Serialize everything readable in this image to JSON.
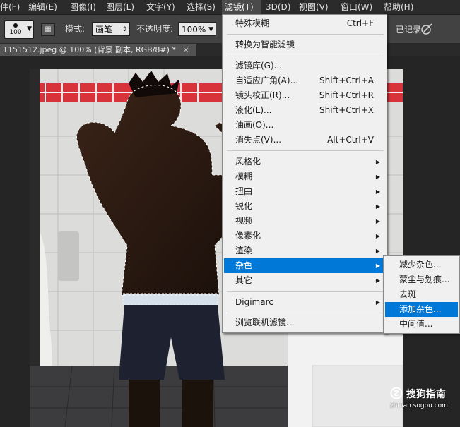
{
  "menubar": {
    "items": [
      {
        "label": "件(F)"
      },
      {
        "label": "编辑(E)"
      },
      {
        "label": "图像(I)"
      },
      {
        "label": "图层(L)"
      },
      {
        "label": "文字(Y)"
      },
      {
        "label": "选择(S)"
      },
      {
        "label": "滤镜(T)"
      },
      {
        "label": "3D(D)"
      },
      {
        "label": "视图(V)"
      },
      {
        "label": "窗口(W)"
      },
      {
        "label": "帮助(H)"
      }
    ]
  },
  "options": {
    "brush_size": "100",
    "mode_label": "模式:",
    "mode_value": "画笔",
    "opacity_label": "不透明度:",
    "opacity_value": "100%",
    "history_label": "已记录"
  },
  "document": {
    "tab_title": "1151512.jpeg @ 100% (背景 副本, RGB/8#) *",
    "close_glyph": "×"
  },
  "filter_menu": {
    "items": [
      {
        "label": "特殊模糊",
        "shortcut": "Ctrl+F"
      },
      {
        "label": "转换为智能滤镜"
      },
      {
        "label": "滤镜库(G)..."
      },
      {
        "label": "自适应广角(A)...",
        "shortcut": "Shift+Ctrl+A"
      },
      {
        "label": "镜头校正(R)...",
        "shortcut": "Shift+Ctrl+R"
      },
      {
        "label": "液化(L)...",
        "shortcut": "Shift+Ctrl+X"
      },
      {
        "label": "油画(O)..."
      },
      {
        "label": "消失点(V)...",
        "shortcut": "Alt+Ctrl+V"
      },
      {
        "label": "风格化"
      },
      {
        "label": "模糊"
      },
      {
        "label": "扭曲"
      },
      {
        "label": "锐化"
      },
      {
        "label": "视频"
      },
      {
        "label": "像素化"
      },
      {
        "label": "渲染"
      },
      {
        "label": "杂色"
      },
      {
        "label": "其它"
      },
      {
        "label": "Digimarc"
      },
      {
        "label": "浏览联机滤镜..."
      }
    ]
  },
  "noise_submenu": {
    "items": [
      {
        "label": "减少杂色..."
      },
      {
        "label": "蒙尘与划痕..."
      },
      {
        "label": "去斑"
      },
      {
        "label": "添加杂色..."
      },
      {
        "label": "中间值..."
      }
    ]
  },
  "watermark": {
    "brand": "搜狗指南",
    "url": "zhinan.sogou.com"
  },
  "colors": {
    "menu_highlight": "#0078d7",
    "tile_red": "#d8333b",
    "wall_white": "#e6e6e4"
  }
}
